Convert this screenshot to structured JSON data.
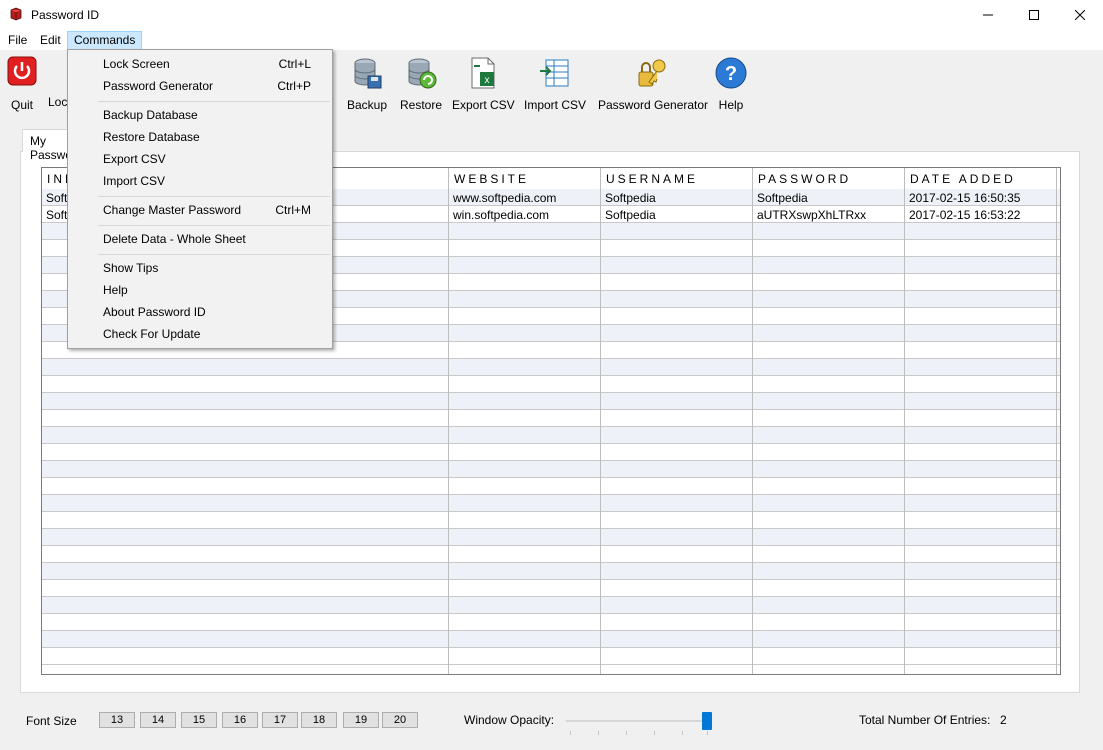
{
  "window": {
    "title": "Password ID"
  },
  "menubar": {
    "items": [
      {
        "label": "File"
      },
      {
        "label": "Edit"
      },
      {
        "label": "Commands"
      }
    ]
  },
  "toolbar": {
    "quit": "Quit",
    "lock": "Lock Screen",
    "backup": "Backup",
    "restore": "Restore",
    "export": "Export CSV",
    "import": "Import CSV",
    "generator": "Password Generator",
    "help": "Help"
  },
  "tab": {
    "label": "My Passwords"
  },
  "table": {
    "columns": [
      "INFO",
      "WEBSITE",
      "USERNAME",
      "PASSWORD",
      "DATE ADDED"
    ],
    "rows": [
      [
        "Softpedia",
        "www.softpedia.com",
        "Softpedia",
        "Softpedia",
        "2017-02-15 16:50:35"
      ],
      [
        "Softpedia",
        "win.softpedia.com",
        "Softpedia",
        "aUTRXswpXhLTRxx",
        "2017-02-15 16:53:22"
      ]
    ]
  },
  "commands_menu": {
    "items": [
      {
        "label": "Lock Screen",
        "shortcut": "Ctrl+L"
      },
      {
        "label": "Password Generator",
        "shortcut": "Ctrl+P"
      },
      {
        "label": "Backup Database",
        "shortcut": ""
      },
      {
        "label": "Restore Database",
        "shortcut": ""
      },
      {
        "label": "Export CSV",
        "shortcut": ""
      },
      {
        "label": "Import CSV",
        "shortcut": ""
      },
      {
        "label": "Change Master Password",
        "shortcut": "Ctrl+M"
      },
      {
        "label": "Delete Data - Whole Sheet",
        "shortcut": ""
      },
      {
        "label": "Show Tips",
        "shortcut": ""
      },
      {
        "label": "Help",
        "shortcut": ""
      },
      {
        "label": "About Password ID",
        "shortcut": ""
      },
      {
        "label": "Check For Update",
        "shortcut": ""
      }
    ]
  },
  "statusbar": {
    "font_size_label": "Font Size",
    "font_sizes": [
      "13",
      "14",
      "15",
      "16",
      "17",
      "18",
      "19",
      "20"
    ],
    "opacity_label": "Window Opacity:",
    "opacity_value": 1.0,
    "total_label": "Total Number Of Entries:",
    "total_value": "2"
  },
  "colors": {
    "accent": "#0078d7",
    "menu_highlight": "#cce8ff",
    "row_alt": "#eef2f8"
  }
}
